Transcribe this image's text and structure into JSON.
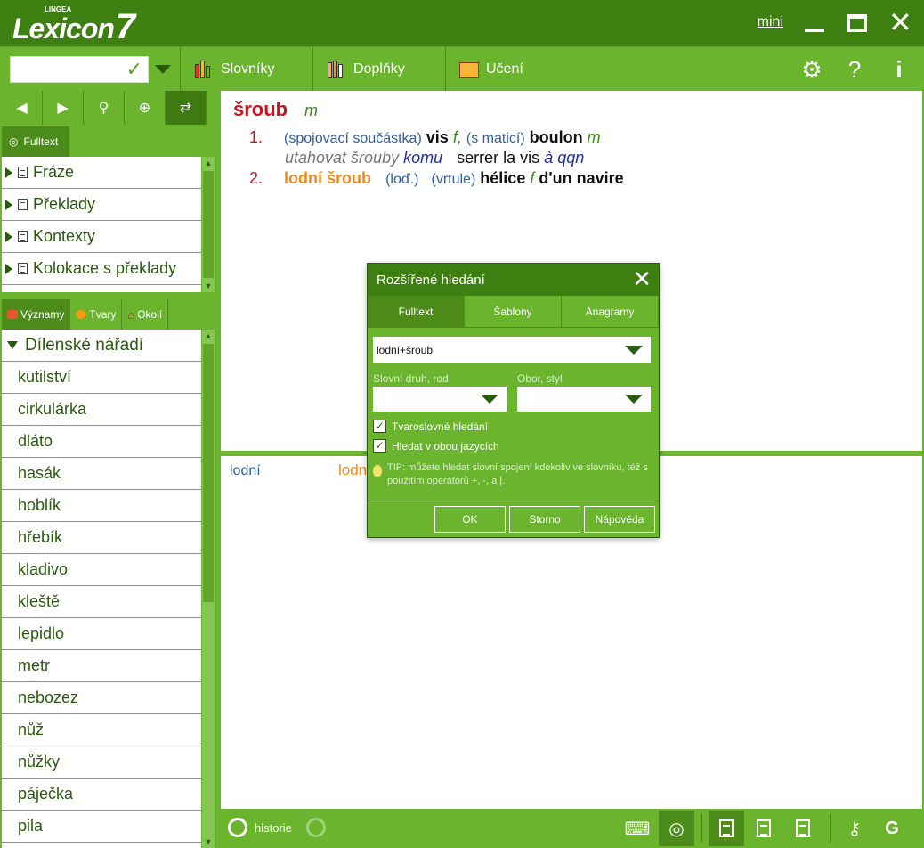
{
  "app": {
    "brand": "Lexicon",
    "brand_suffix": "7",
    "brand_maker": "LINGEA",
    "mini_label": "mini"
  },
  "toolbar": {
    "search_value": "",
    "slovniky": "Slovníky",
    "doplnky": "Doplňky",
    "uceni": "Učení"
  },
  "left": {
    "fulltext_tab": "Fulltext",
    "list1": [
      "Fráze",
      "Překlady",
      "Kontexty",
      "Kolokace s překlady"
    ],
    "tabs2": [
      "Významy",
      "Tvary",
      "Okolí"
    ],
    "category": "Dílenské nářadí",
    "items": [
      "kutilství",
      "cirkulárka",
      "dláto",
      "hasák",
      "hoblík",
      "hřebík",
      "kladivo",
      "kleště",
      "lepidlo",
      "metr",
      "nebozez",
      "nůž",
      "nůžky",
      "páječka",
      "pila"
    ]
  },
  "entry": {
    "headword": "šroub",
    "gram": "m",
    "s1_num": "1.",
    "s1_note1": "(spojovací součástka)",
    "s1_tr1": "vis",
    "s1_g1": "f,",
    "s1_note2": "(s maticí)",
    "s1_tr2": "boulon",
    "s1_g2": "m",
    "ex_cz": "utahovat šrouby",
    "ex_komu": "komu",
    "ex_fr": "serrer la vis",
    "ex_qqn": "à qqn",
    "s2_num": "2.",
    "s2_hw": "lodní šroub",
    "s2_note1": "(loď.)",
    "s2_note2": "(vrtule)",
    "s2_tr": "hélice",
    "s2_g": "f",
    "s2_rest": "d'un navire"
  },
  "results": {
    "left": "lodní",
    "right": "lodn"
  },
  "bottom": {
    "history": "historie"
  },
  "dialog": {
    "title": "Rozšířené hledání",
    "tabs": [
      "Fulltext",
      "Šablony",
      "Anagramy"
    ],
    "query": "lodní+šroub",
    "label_pos": "Slovní druh, rod",
    "label_field": "Obor, styl",
    "check1": "Tvaroslovné hledání",
    "check2": "Hledat v obou jazycích",
    "tip": "TIP: můžete hledat slovní spojení kdekoliv ve slovníku, též s použitím operátorů +, -, a |.",
    "ok": "OK",
    "cancel": "Storno",
    "help": "Nápověda"
  }
}
